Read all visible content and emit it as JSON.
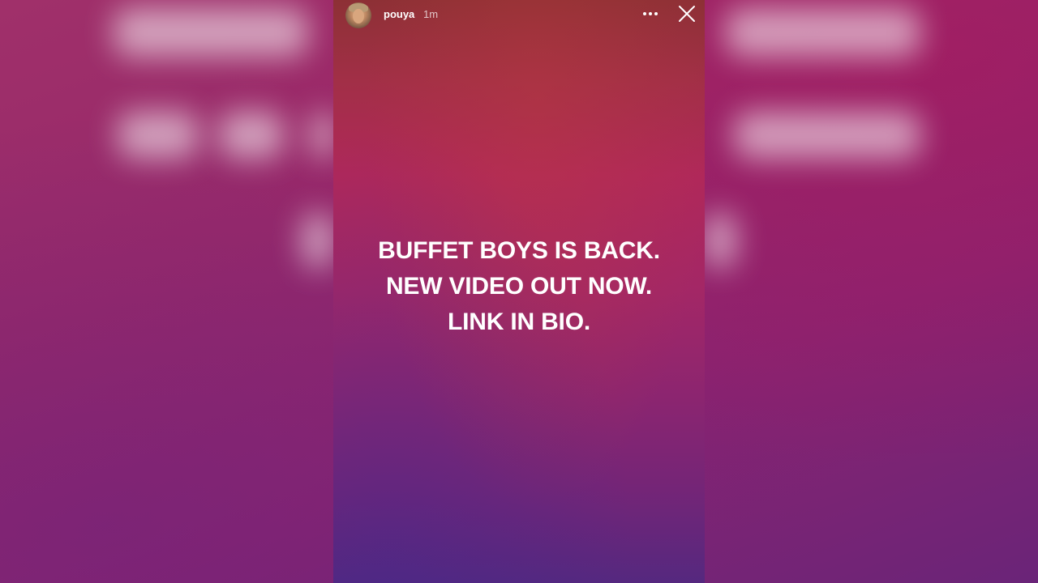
{
  "story": {
    "user": {
      "username": "pouya",
      "time_ago": "1m"
    },
    "text_lines": [
      "BUFFET BOYS IS BACK.",
      "NEW VIDEO OUT NOW.",
      "LINK IN BIO."
    ],
    "icons": {
      "more": "more-options-icon",
      "close": "close-icon",
      "avatar": "user-avatar"
    }
  },
  "colors": {
    "gradient_top": "#8d3035",
    "gradient_mid": "#b0285a",
    "gradient_bottom": "#55287f",
    "text": "#ffffff"
  }
}
